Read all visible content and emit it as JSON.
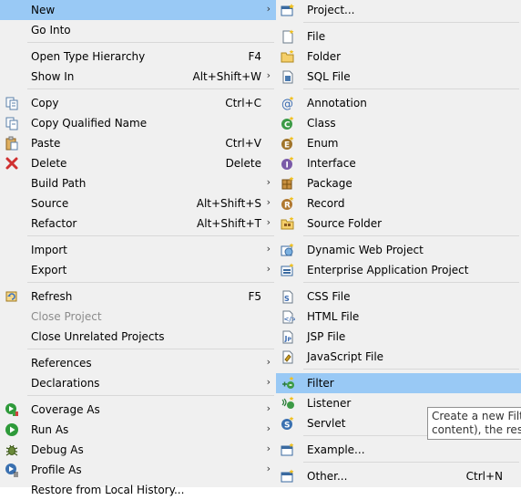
{
  "left_menu": {
    "new": {
      "label": "New"
    },
    "go_into": {
      "label": "Go Into"
    },
    "open_type_hierarchy": {
      "label": "Open Type Hierarchy",
      "shortcut": "F4"
    },
    "show_in": {
      "label": "Show In",
      "shortcut": "Alt+Shift+W"
    },
    "copy": {
      "label": "Copy",
      "shortcut": "Ctrl+C"
    },
    "copy_qualified_name": {
      "label": "Copy Qualified Name"
    },
    "paste": {
      "label": "Paste",
      "shortcut": "Ctrl+V"
    },
    "delete": {
      "label": "Delete",
      "shortcut": "Delete"
    },
    "build_path": {
      "label": "Build Path"
    },
    "source": {
      "label": "Source",
      "shortcut": "Alt+Shift+S"
    },
    "refactor": {
      "label": "Refactor",
      "shortcut": "Alt+Shift+T"
    },
    "import": {
      "label": "Import"
    },
    "export": {
      "label": "Export"
    },
    "refresh": {
      "label": "Refresh",
      "shortcut": "F5"
    },
    "close_project": {
      "label": "Close Project"
    },
    "close_unrelated_projects": {
      "label": "Close Unrelated Projects"
    },
    "references": {
      "label": "References"
    },
    "declarations": {
      "label": "Declarations"
    },
    "coverage_as": {
      "label": "Coverage As"
    },
    "run_as": {
      "label": "Run As"
    },
    "debug_as": {
      "label": "Debug As"
    },
    "profile_as": {
      "label": "Profile As"
    },
    "restore_local_history": {
      "label": "Restore from Local History..."
    }
  },
  "right_menu": {
    "project": {
      "label": "Project..."
    },
    "file": {
      "label": "File"
    },
    "folder": {
      "label": "Folder"
    },
    "sql_file": {
      "label": "SQL File"
    },
    "annotation": {
      "label": "Annotation"
    },
    "class": {
      "label": "Class"
    },
    "enum": {
      "label": "Enum"
    },
    "interface": {
      "label": "Interface"
    },
    "package": {
      "label": "Package"
    },
    "record": {
      "label": "Record"
    },
    "source_folder": {
      "label": "Source Folder"
    },
    "dynamic_web_project": {
      "label": "Dynamic Web Project"
    },
    "enterprise_application_project": {
      "label": "Enterprise Application Project"
    },
    "css_file": {
      "label": "CSS File"
    },
    "html_file": {
      "label": "HTML File"
    },
    "jsp_file": {
      "label": "JSP File"
    },
    "javascript_file": {
      "label": "JavaScript File"
    },
    "filter": {
      "label": "Filter"
    },
    "listener": {
      "label": "Listener"
    },
    "servlet": {
      "label": "Servlet"
    },
    "example": {
      "label": "Example..."
    },
    "other": {
      "label": "Other...",
      "shortcut": "Ctrl+N"
    }
  },
  "tooltip": {
    "line1": "Create a new Filter",
    "line2": "content), the respo"
  },
  "colors": {
    "highlight": "#99c9f5",
    "menu_bg": "#f0f0f0",
    "disabled_text": "#8c8c8c"
  }
}
